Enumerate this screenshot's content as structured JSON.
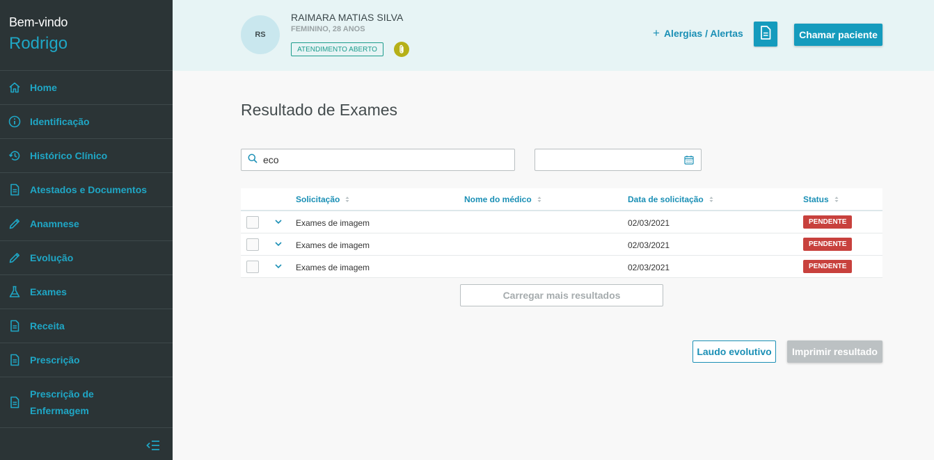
{
  "sidebar": {
    "greeting": "Bem-vindo",
    "user_name": "Rodrigo",
    "items": [
      {
        "label": "Home",
        "icon": "home-icon"
      },
      {
        "label": "Identificação",
        "icon": "info-icon"
      },
      {
        "label": "Histórico Clínico",
        "icon": "history-icon"
      },
      {
        "label": "Atestados e Documentos",
        "icon": "document-icon"
      },
      {
        "label": "Anamnese",
        "icon": "pencil-icon"
      },
      {
        "label": "Evolução",
        "icon": "pencil-icon"
      },
      {
        "label": "Exames",
        "icon": "flask-icon"
      },
      {
        "label": "Receita",
        "icon": "document-icon"
      },
      {
        "label": "Prescrição",
        "icon": "document-icon"
      },
      {
        "label": "Prescrição de Enfermagem",
        "icon": "document-icon"
      }
    ],
    "collapse_icon": "collapse-menu-icon"
  },
  "header": {
    "avatar_initials": "RS",
    "patient_name": "RAIMARA MATIAS SILVA",
    "patient_info": "FEMININO, 28 ANOS",
    "status_badge": "ATENDIMENTO ABERTO",
    "attachment_icon": "paperclip-icon",
    "alerts_label": "Alergias / Alertas",
    "alerts_plus": "+",
    "document_icon": "document-icon",
    "call_button": "Chamar paciente"
  },
  "main": {
    "title": "Resultado de Exames",
    "search": {
      "value": "eco",
      "icon": "search-icon"
    },
    "date_filter": {
      "value": "",
      "icon": "calendar-icon"
    },
    "table": {
      "columns": [
        "Solicitação",
        "Nome do médico",
        "Data de solicitação",
        "Status"
      ],
      "rows": [
        {
          "solicitacao": "Exames de imagem",
          "medico": "",
          "data": "02/03/2021",
          "status": "PENDENTE"
        },
        {
          "solicitacao": "Exames de imagem",
          "medico": "",
          "data": "02/03/2021",
          "status": "PENDENTE"
        },
        {
          "solicitacao": "Exames de imagem",
          "medico": "",
          "data": "02/03/2021",
          "status": "PENDENTE"
        }
      ]
    },
    "load_more": "Carregar mais resultados",
    "laudo_button": "Laudo evolutivo",
    "print_button": "Imprimir resultado"
  },
  "colors": {
    "accent": "#159bbd",
    "sidebar_bg": "#2b3436",
    "header_bg": "#e7f4f5",
    "pending": "#c8413d",
    "open_badge": "#1c9c8c"
  }
}
